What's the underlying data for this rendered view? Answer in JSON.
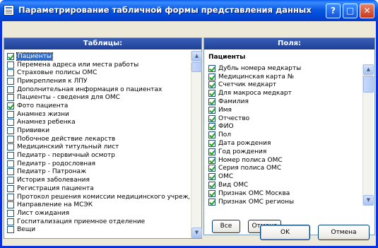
{
  "window": {
    "title": "Параметрирование табличной формы представления данных",
    "help_button": "?",
    "maximize_button": "□",
    "close_button": "✕"
  },
  "tables_panel": {
    "header": "Таблицы:",
    "items": [
      {
        "label": "Пациенты",
        "checked": true,
        "selected": true
      },
      {
        "label": "Перемена адреса или места работы",
        "checked": false
      },
      {
        "label": "Страховые полисы ОМС",
        "checked": false
      },
      {
        "label": "Прикрепления к ЛПУ",
        "checked": false
      },
      {
        "label": "Дополнительная информация о пациентах",
        "checked": false
      },
      {
        "label": "Пациенты - сведения для ОМС",
        "checked": false
      },
      {
        "label": "Фото пациента",
        "checked": true
      },
      {
        "label": "Анамнез жизни",
        "checked": false
      },
      {
        "label": "Анамнез ребенка",
        "checked": false
      },
      {
        "label": "Прививки",
        "checked": false
      },
      {
        "label": "Побочное действие лекарств",
        "checked": false
      },
      {
        "label": "Медицинский титульный лист",
        "checked": false
      },
      {
        "label": "Педиатр - первичный осмотр",
        "checked": false
      },
      {
        "label": "Педиатр - родословная",
        "checked": false
      },
      {
        "label": "Педиатр - Патронаж",
        "checked": false
      },
      {
        "label": "История заболевания",
        "checked": false
      },
      {
        "label": "Регистрация пациента",
        "checked": false
      },
      {
        "label": "Протокол решения комиссии медицинского учреждения",
        "checked": false
      },
      {
        "label": "Направление на МСЭК",
        "checked": false
      },
      {
        "label": "Лист ожидания",
        "checked": false
      },
      {
        "label": "Госпитализация приемное отделение",
        "checked": false
      },
      {
        "label": "Вещи",
        "checked": false
      }
    ]
  },
  "fields_panel": {
    "header": "Поля:",
    "title": "Пациенты",
    "items": [
      {
        "label": "Дубль номера медкарты",
        "checked": true
      },
      {
        "label": "Медицинская карта №",
        "checked": true
      },
      {
        "label": "Счетчик медкарт",
        "checked": true
      },
      {
        "label": "Для макроса медкарт",
        "checked": true
      },
      {
        "label": "Фамилия",
        "checked": true
      },
      {
        "label": "Имя",
        "checked": true
      },
      {
        "label": "Отчество",
        "checked": true
      },
      {
        "label": "ФИО",
        "checked": true
      },
      {
        "label": "Пол",
        "checked": true
      },
      {
        "label": "Дата рождения",
        "checked": true
      },
      {
        "label": "Год рождения",
        "checked": true
      },
      {
        "label": "Номер полиса ОМС",
        "checked": true
      },
      {
        "label": "Серия полиса ОМС",
        "checked": true
      },
      {
        "label": "ОМС",
        "checked": true
      },
      {
        "label": "Вид ОМС",
        "checked": true
      },
      {
        "label": "Признак ОМС Москва",
        "checked": true
      },
      {
        "label": "Признак ОМС регионы",
        "checked": true
      }
    ],
    "select_all_button": "Все",
    "cancel_button": "Отмена"
  },
  "footer": {
    "ok_button": "OK",
    "cancel_button": "Отмена"
  }
}
